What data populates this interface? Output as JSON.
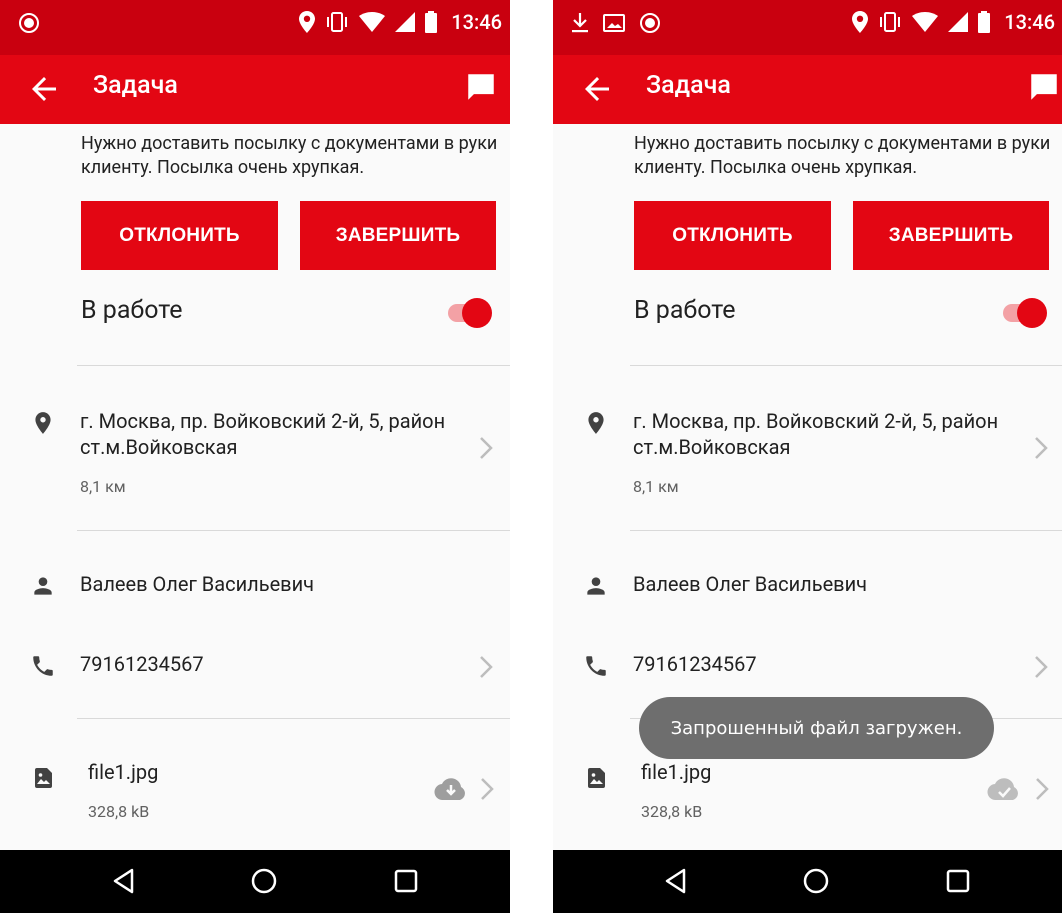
{
  "status_bar": {
    "time": "13:46"
  },
  "app_bar": {
    "title": "Задача"
  },
  "task": {
    "description": "Нужно доставить посылку с документами в руки клиенту. Посылка очень хрупкая.",
    "reject_label": "ОТКЛОНИТЬ",
    "finish_label": "ЗАВЕРШИТЬ",
    "status_label": "В работе",
    "in_work": true
  },
  "address": {
    "line": "г. Москва, пр. Войковский 2-й, 5, район ст.м.Войковская",
    "distance": "8,1 км"
  },
  "contact": {
    "name": "Валеев Олег Васильевич",
    "phone": "79161234567"
  },
  "file": {
    "name": "file1.jpg",
    "size": "328,8 kB"
  },
  "toast": {
    "message": "Запрошенный файл загружен."
  },
  "colors": {
    "primary": "#e30613",
    "status_bar": "#c9000f"
  }
}
